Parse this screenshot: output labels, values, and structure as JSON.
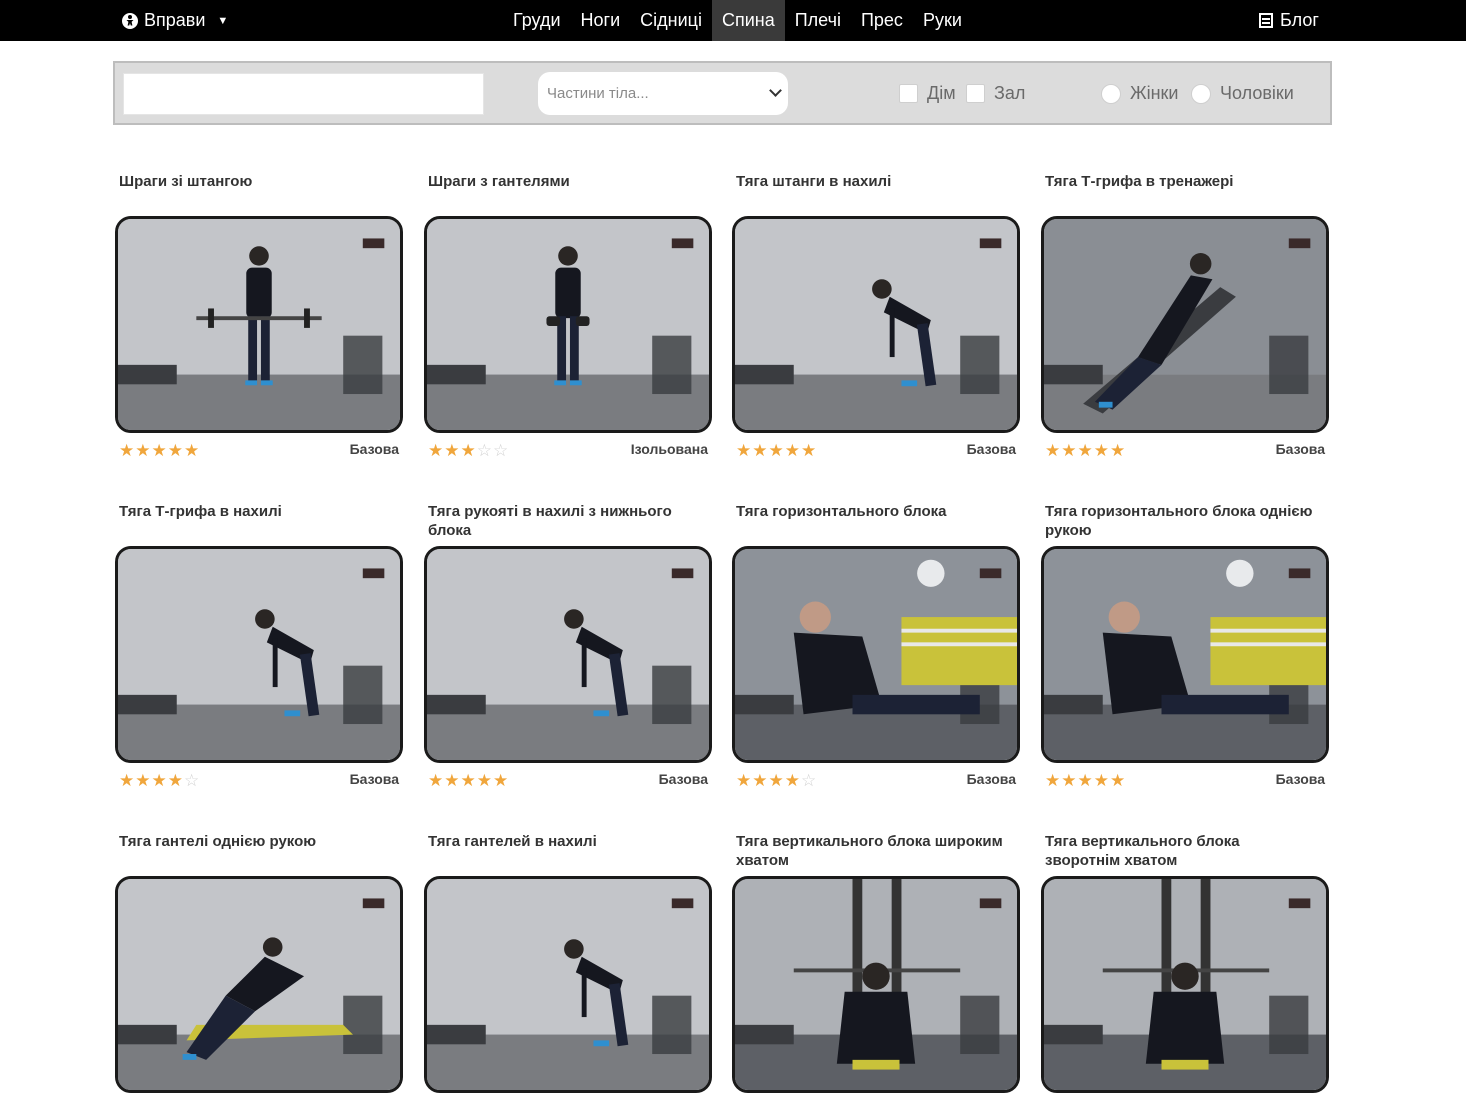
{
  "nav": {
    "brand": "Вправи",
    "items": [
      "Груди",
      "Ноги",
      "Сідниці",
      "Спина",
      "Плечі",
      "Прес",
      "Руки"
    ],
    "active": "Спина",
    "blog": "Блог"
  },
  "filters": {
    "search_value": "",
    "body_parts_placeholder": "Частини тіла...",
    "place_home": "Дім",
    "place_gym": "Зал",
    "gender_women": "Жінки",
    "gender_men": "Чоловіки"
  },
  "colors": {
    "star": "#f0a63c",
    "star_empty": "#d2d2d2",
    "nav_bg": "#000000",
    "nav_active": "#3a3a3a"
  },
  "exercises": [
    {
      "title": "Шраги зі штангою",
      "rating": 5,
      "type": "Базова",
      "scene": "barbell-standing"
    },
    {
      "title": "Шраги з гантелями",
      "rating": 3,
      "type": "Ізольована",
      "scene": "dumbbell-standing"
    },
    {
      "title": "Тяга штанги в нахилі",
      "rating": 5,
      "type": "Базова",
      "scene": "bent-row"
    },
    {
      "title": "Тяга Т-грифа в тренажері",
      "rating": 5,
      "type": "Базова",
      "scene": "t-bar-machine"
    },
    {
      "title": "Тяга Т-грифа в нахилі",
      "rating": 4,
      "type": "Базова",
      "scene": "t-bar-bent"
    },
    {
      "title": "Тяга рукояті в нахилі з нижнього блока",
      "rating": 5,
      "type": "Базова",
      "scene": "cable-bent"
    },
    {
      "title": "Тяга горизонтального блока",
      "rating": 4,
      "type": "Базова",
      "scene": "seated-row"
    },
    {
      "title": "Тяга горизонтального блока однією рукою",
      "rating": 5,
      "type": "Базова",
      "scene": "seated-row-one"
    },
    {
      "title": "Тяга гантелі однією рукою",
      "rating": null,
      "type": null,
      "scene": "one-arm-db"
    },
    {
      "title": "Тяга гантелей в нахилі",
      "rating": null,
      "type": null,
      "scene": "db-bent"
    },
    {
      "title": "Тяга вертикального блока широким хватом",
      "rating": null,
      "type": null,
      "scene": "lat-wide"
    },
    {
      "title": "Тяга вертикального блока зворотнім хватом",
      "rating": null,
      "type": null,
      "scene": "lat-reverse"
    }
  ]
}
